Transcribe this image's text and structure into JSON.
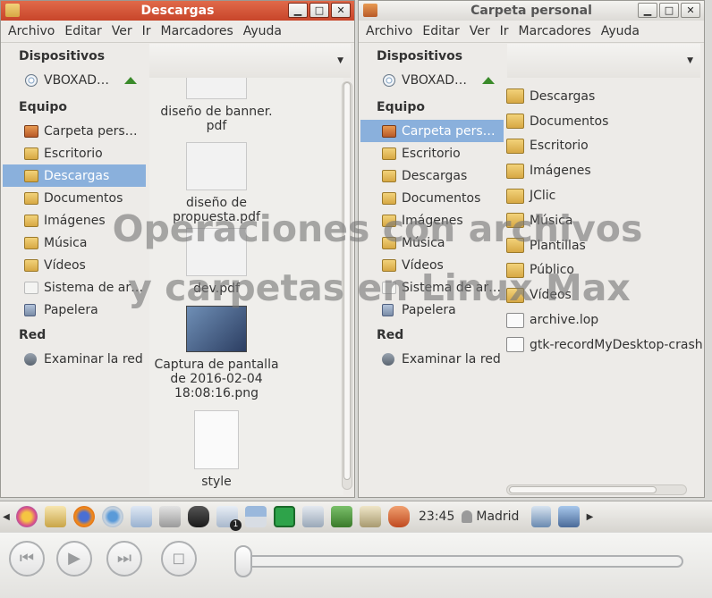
{
  "window_left": {
    "title": "Descargas",
    "menu": [
      "Archivo",
      "Editar",
      "Ver",
      "Ir",
      "Marcadores",
      "Ayuda"
    ],
    "sidebar": {
      "devices_header": "Dispositivos",
      "device": "VBOXAD…",
      "equipo_header": "Equipo",
      "items": [
        "Carpeta pers…",
        "Escritorio",
        "Descargas",
        "Documentos",
        "Imágenes",
        "Música",
        "Vídeos",
        "Sistema de ar…",
        "Papelera"
      ],
      "selected": "Descargas",
      "red_header": "Red",
      "red_item": "Examinar la red"
    },
    "files": [
      {
        "name_line1": "diseño de banner.",
        "name_line2": "pdf"
      },
      {
        "name_line1": "diseño de",
        "name_line2": "propuesta.pdf"
      },
      {
        "name_line1": "dev.pdf",
        "name_line2": ""
      },
      {
        "name_line1": "Captura de pantalla",
        "name_line2": "de 2016-02-04",
        "name_line3": "18:08:16.png"
      },
      {
        "name_line1": "style",
        "name_line2": ""
      }
    ]
  },
  "window_right": {
    "title": "Carpeta personal",
    "menu": [
      "Archivo",
      "Editar",
      "Ver",
      "Ir",
      "Marcadores",
      "Ayuda"
    ],
    "sidebar": {
      "devices_header": "Dispositivos",
      "device": "VBOXAD…",
      "equipo_header": "Equipo",
      "items": [
        "Carpeta pers…",
        "Escritorio",
        "Descargas",
        "Documentos",
        "Imágenes",
        "Música",
        "Vídeos",
        "Sistema de ar…",
        "Papelera"
      ],
      "selected": "Carpeta pers…",
      "red_header": "Red",
      "red_item": "Examinar la red"
    },
    "list": [
      "Descargas",
      "Documentos",
      "Escritorio",
      "Imágenes",
      "JClic",
      "Música",
      "Plantillas",
      "Público",
      "Vídeos",
      "archive.lop",
      "gtk-recordMyDesktop-crash"
    ]
  },
  "watermark": {
    "line1": "Operaciones con archivos",
    "line2": "y carpetas en Linux Max"
  },
  "taskbar": {
    "clock": "23:45",
    "user": "Madrid",
    "badge": "1"
  },
  "player": {
    "buttons": [
      "rewind",
      "play",
      "fast-forward",
      "stop"
    ],
    "progress": 0.0
  },
  "colors": {
    "active_title": "#d0502f",
    "selection": "#8ab0dc",
    "folder": "#e4bd5a"
  }
}
